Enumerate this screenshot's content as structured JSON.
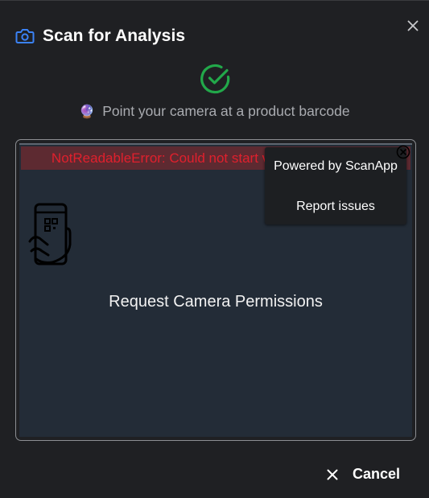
{
  "dialog": {
    "title": "Scan for Analysis",
    "title_icon": "camera-icon",
    "close_icon": "close-icon",
    "status_icon": "check-circle-icon",
    "hint_emoji": "🔮",
    "hint_text": "Point your camera at a product barcode"
  },
  "scanner": {
    "error_text": "NotReadableError: Could not start video source",
    "powered_by": "Powered by ScanApp",
    "report_issues": "Report issues",
    "request_permissions": "Request Camera Permissions",
    "placeholder_icon": "phone-scan-icon"
  },
  "footer": {
    "cancel_label": "Cancel",
    "cancel_icon": "close-icon"
  },
  "colors": {
    "accent_blue": "#3b82f6",
    "success_green": "#22a84a",
    "error_red": "#e0202d",
    "background": "#1f2023",
    "scanner_bg": "#232c37"
  }
}
